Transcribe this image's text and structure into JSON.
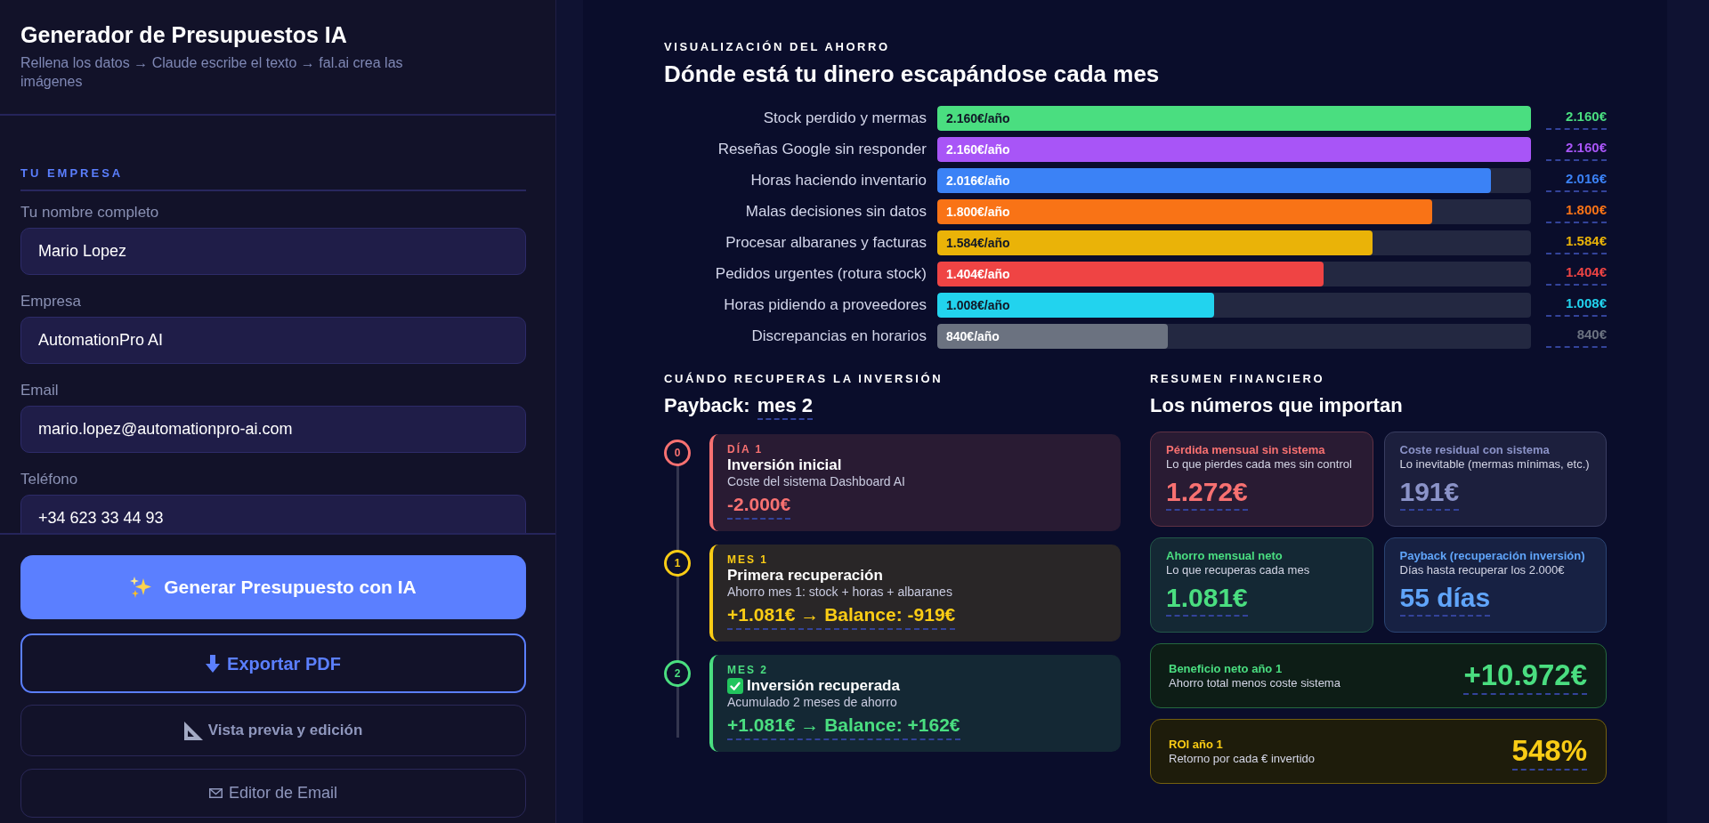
{
  "sidebar": {
    "title": "Generador de Presupuestos IA",
    "subtitle": "Rellena los datos → Claude escribe el texto → fal.ai crea las imágenes",
    "section": "TU EMPRESA",
    "fields": [
      {
        "label": "Tu nombre completo",
        "value": "Mario Lopez"
      },
      {
        "label": "Empresa",
        "value": "AutomationPro AI"
      },
      {
        "label": "Email",
        "value": "mario.lopez@automationpro-ai.com"
      },
      {
        "label": "Teléfono",
        "value": "+34 623 33 44 93"
      }
    ],
    "buttons": [
      {
        "kind": "primary",
        "label": "Generar Presupuesto con IA"
      },
      {
        "kind": "outline",
        "label": "Exportar PDF"
      },
      {
        "kind": "secondary",
        "label": "Vista previa y edición"
      },
      {
        "kind": "plain",
        "label": "Editor de Email"
      }
    ]
  },
  "savings": {
    "label": "VISUALIZACIÓN DEL AHORRO",
    "title": "Dónde está tu dinero escapándose cada mes",
    "rows": [
      {
        "label": "Stock perdido y mermas",
        "value_label": "2.160€/año",
        "level": 1,
        "color": "#4ade80",
        "amount": "2.160€"
      },
      {
        "label": "Reseñas Google sin responder",
        "value_label": "2.160€/año",
        "level": 1,
        "color": "#a855f7",
        "amount": "2.160€"
      },
      {
        "label": "Horas haciendo inventario",
        "value_label": "2.016€/año",
        "level": 0.933,
        "color": "#3b82f6",
        "amount": "2.016€"
      },
      {
        "label": "Malas decisiones sin datos",
        "value_label": "1.800€/año",
        "level": 0.833,
        "color": "#f97316",
        "amount": "1.800€"
      },
      {
        "label": "Procesar albaranes y facturas",
        "value_label": "1.584€/año",
        "level": 0.733,
        "color": "#eab308",
        "amount": "1.584€"
      },
      {
        "label": "Pedidos urgentes (rotura stock)",
        "value_label": "1.404€/año",
        "level": 0.65,
        "color": "#ef4444",
        "amount": "1.404€"
      },
      {
        "label": "Horas pidiendo a proveedores",
        "value_label": "1.008€/año",
        "level": 0.467,
        "color": "#22d3ee",
        "amount": "1.008€"
      },
      {
        "label": "Discrepancias en horarios",
        "value_label": "840€/año",
        "level": 0.389,
        "color": "#6b7280",
        "amount": "840€"
      }
    ]
  },
  "payback": {
    "label": "CUÁNDO RECUPERAS LA INVERSIÓN",
    "title": "Payback:",
    "title_value": "mes 2",
    "steps": [
      {
        "number": "0",
        "label": "DÍA 1",
        "title": "Inversión inicial",
        "description": "Coste del sistema Dashboard AI",
        "value": "-2.000€",
        "color": "#f87171",
        "done": false
      },
      {
        "number": "1",
        "label": "MES 1",
        "title": "Primera recuperación",
        "description": "Ahorro mes 1: stock + horas + albaranes",
        "value": "+1.081€ → Balance: -919€",
        "color": "#facc15",
        "done": false
      },
      {
        "number": "2",
        "label": "MES 2",
        "title": "Inversión recuperada",
        "description": "Acumulado 2 meses de ahorro",
        "value": "+1.081€ → Balance: +162€",
        "color": "#4ade80",
        "done": true
      }
    ]
  },
  "summary": {
    "label": "RESUMEN FINANCIERO",
    "title": "Los números que importan",
    "cards": [
      {
        "kind": "tile",
        "color": "#f87171",
        "title": "Pérdida mensual sin sistema",
        "description": "Lo que pierdes cada mes sin control",
        "value": "1.272€"
      },
      {
        "kind": "tile",
        "color": "#8b93c8",
        "title": "Coste residual con sistema",
        "description": "Lo inevitable (mermas mínimas, etc.)",
        "value": "191€"
      },
      {
        "kind": "tile",
        "color": "#4ade80",
        "title": "Ahorro mensual neto",
        "description": "Lo que recuperas cada mes",
        "value": "1.081€"
      },
      {
        "kind": "tile",
        "color": "#60a5fa",
        "title": "Payback (recuperación inversión)",
        "description": "Días hasta recuperar los 2.000€",
        "value": "55 días"
      },
      {
        "kind": "wide",
        "color": "#4ade80",
        "title": "Beneficio neto año 1",
        "description": "Ahorro total menos coste sistema",
        "value": "+10.972€"
      },
      {
        "kind": "wide",
        "color": "#facc15",
        "title": "ROI año 1",
        "description": "Retorno por cada € invertido",
        "value": "548%"
      }
    ]
  }
}
